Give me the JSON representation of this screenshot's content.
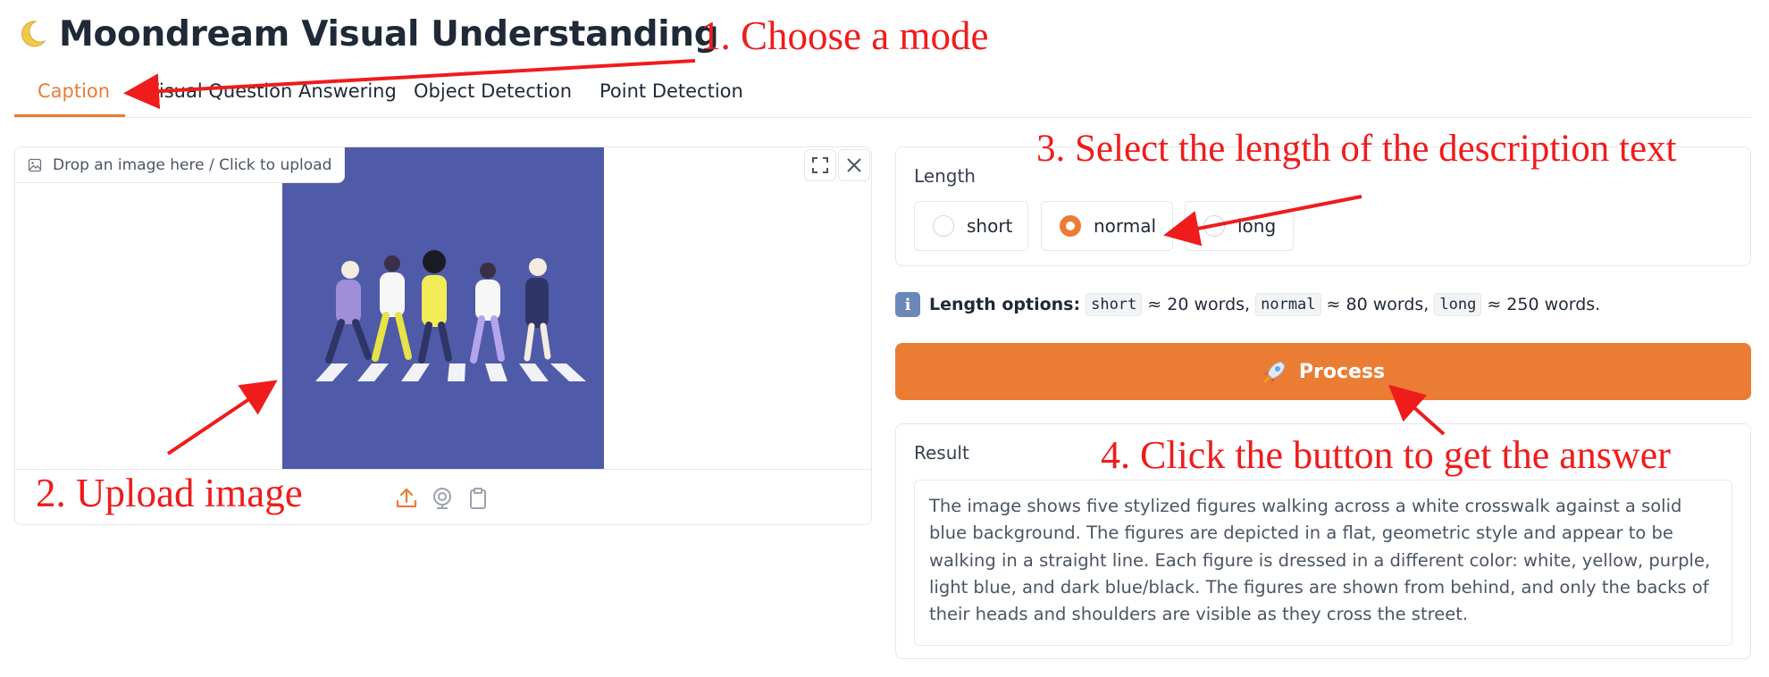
{
  "app": {
    "title": "Moondream Visual Understanding",
    "title_icon": "crescent-moon-icon"
  },
  "tabs": [
    {
      "label": "Caption",
      "active": true
    },
    {
      "label": "Visual Question Answering",
      "active": false
    },
    {
      "label": "Object Detection",
      "active": false
    },
    {
      "label": "Point Detection",
      "active": false
    }
  ],
  "image_input": {
    "label": "Drop an image here / Click to upload",
    "label_icon": "image-icon",
    "controls": [
      "fullscreen-icon",
      "close-icon"
    ],
    "toolbar_icons": [
      "upload-icon",
      "webcam-icon",
      "clipboard-icon"
    ]
  },
  "length": {
    "label": "Length",
    "options": [
      "short",
      "normal",
      "long"
    ],
    "selected": "normal"
  },
  "info": {
    "icon": "info-icon",
    "icon_glyph": "i",
    "bold": "Length options:",
    "short_code": "short",
    "short_text": "≈ 20 words,",
    "normal_code": "normal",
    "normal_text": "≈ 80 words,",
    "long_code": "long",
    "long_text": "≈ 250 words."
  },
  "process_button": {
    "label": "Process",
    "icon": "rocket-icon"
  },
  "result": {
    "label": "Result",
    "text": "The image shows five stylized figures walking across a white crosswalk against a solid blue background. The figures are depicted in a flat, geometric style and appear to be walking in a straight line. Each figure is dressed in a different color: white, yellow, purple, light blue, and dark blue/black. The figures are shown from behind, and only the backs of their heads and shoulders are visible as they cross the street."
  },
  "annotations": {
    "step1": "1. Choose a mode",
    "step2": "2. Upload image",
    "step3": "3. Select the length of the description text",
    "step4": "4. Click the button to get the answer"
  },
  "colors": {
    "accent": "#ea7c34",
    "annotation_red": "#ef1c1c",
    "image_background": "#4f5ba8",
    "border": "#e5e7eb"
  }
}
